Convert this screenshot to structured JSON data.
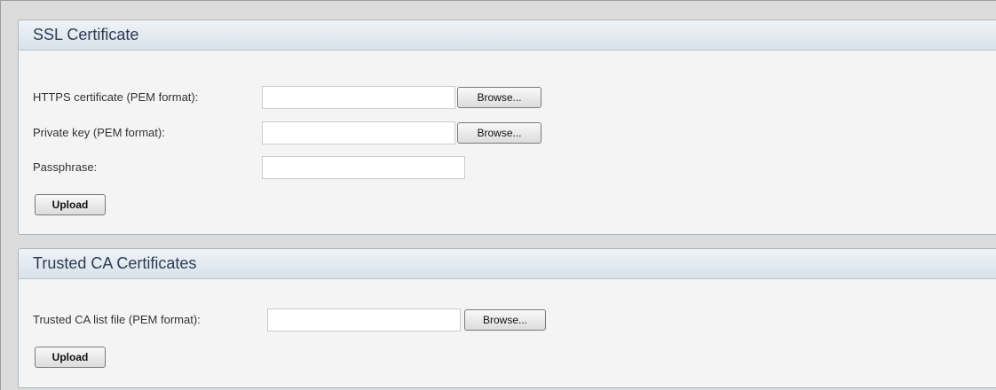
{
  "ssl": {
    "title": "SSL Certificate",
    "https_label": "HTTPS certificate (PEM format):",
    "https_value": "",
    "key_label": "Private key (PEM format):",
    "key_value": "",
    "passphrase_label": "Passphrase:",
    "passphrase_value": "",
    "browse_label": "Browse...",
    "upload_label": "Upload"
  },
  "ca": {
    "title": "Trusted CA Certificates",
    "list_label": "Trusted CA list file (PEM format):",
    "list_value": "",
    "browse_label": "Browse...",
    "upload_label": "Upload"
  },
  "colors": {
    "header_text": "#2a3d54",
    "panel_bg": "#f4f4f4",
    "border": "#a9b7c2"
  }
}
